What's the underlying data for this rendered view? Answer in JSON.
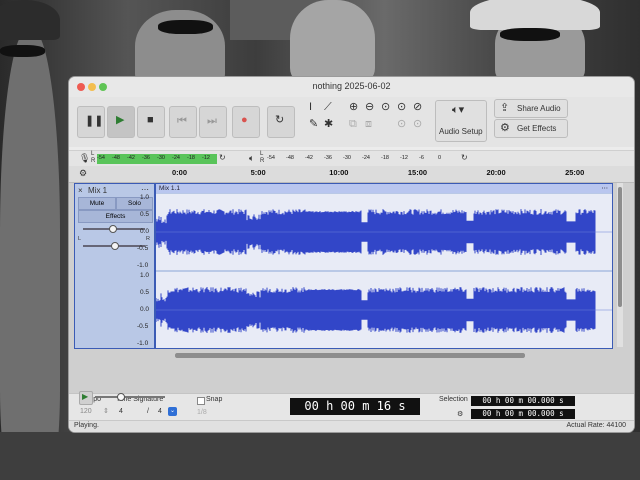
{
  "window": {
    "title": "nothing 2025-06-02"
  },
  "toolbar": {
    "audio_setup_label": "Audio Setup",
    "share_audio_label": "Share Audio",
    "get_effects_label": "Get Effects"
  },
  "meters": {
    "record_scale": [
      "-54",
      "-48",
      "-42",
      "-36",
      "-30",
      "-24",
      "-18",
      "-12"
    ],
    "play_scale": [
      "-54",
      "-48",
      "-42",
      "-36",
      "-30",
      "-24",
      "-18",
      "-12",
      "-6",
      "0"
    ],
    "channel_L": "L",
    "channel_R": "R"
  },
  "ruler": {
    "ticks": [
      "0:00",
      "5:00",
      "10:00",
      "15:00",
      "20:00",
      "25:00"
    ]
  },
  "track": {
    "name": "Mix 1",
    "mute_label": "Mute",
    "solo_label": "Solo",
    "effects_label": "Effects",
    "pan_left": "L",
    "pan_right": "R",
    "clip_name": "Mix 1.1",
    "scale_labels": [
      "1.0",
      "0.5",
      "0.0",
      "-0.5",
      "-1.0"
    ]
  },
  "bottom": {
    "tempo_label": "Tempo",
    "tempo_value": "120",
    "time_sig_label": "Time Signature",
    "time_sig_num": "4",
    "time_sig_sep": "/",
    "time_sig_den": "4",
    "snap_label": "Snap",
    "snap_value": "1/8",
    "main_time": "00 h 00 m 16 s",
    "selection_label": "Selection",
    "selection_start": "00 h 00 m 00.000 s",
    "selection_end": "00 h 00 m 00.000 s"
  },
  "status": {
    "left": "Playing.",
    "right": "Actual Rate: 44100"
  },
  "colors": {
    "waveform": "#3246c8",
    "track_border": "#3b5bb5",
    "meter_green": "#59c45a",
    "record_red": "#d9534f"
  }
}
